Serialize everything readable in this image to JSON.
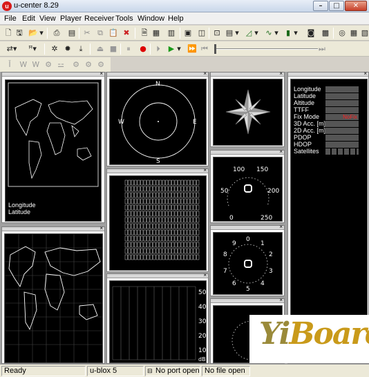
{
  "window": {
    "title": "u-center 8.29",
    "logo_text": "u",
    "buttons": {
      "minimize": "–",
      "maximize": "□",
      "close": "✕"
    }
  },
  "menu": [
    "File",
    "Edit",
    "View",
    "Player",
    "Receiver",
    "Tools",
    "Window",
    "Help"
  ],
  "map_pane": {
    "longitude_label": "Longitude",
    "latitude_label": "Latitude"
  },
  "sky_view": {
    "n": "N",
    "e": "E",
    "s": "S",
    "w": "W"
  },
  "speedometer": {
    "ticks": [
      "0",
      "50",
      "100",
      "150",
      "200",
      "250"
    ]
  },
  "clock": {
    "ticks": [
      "0",
      "1",
      "2",
      "3",
      "4",
      "5",
      "6",
      "7",
      "8",
      "9"
    ]
  },
  "signal_chart": {
    "ticks": [
      "50",
      "40",
      "30",
      "20",
      "10"
    ],
    "unit": "dB"
  },
  "info_panel": {
    "rows": [
      "Longitude",
      "Latitude",
      "Altitude",
      "TTFF",
      "Fix Mode",
      "3D Acc. [m]",
      "2D Acc. [m]",
      "PDOP",
      "HDOP",
      "Satellites"
    ],
    "fix_mode_value": "NoFix",
    "fix_mode_color": "#ff2020"
  },
  "statusbar": {
    "ready": "Ready",
    "receiver": "u-blox 5",
    "port": "No port open",
    "file": "No file open"
  },
  "watermark": {
    "text_yi": "Yi",
    "text_board": "Board"
  }
}
